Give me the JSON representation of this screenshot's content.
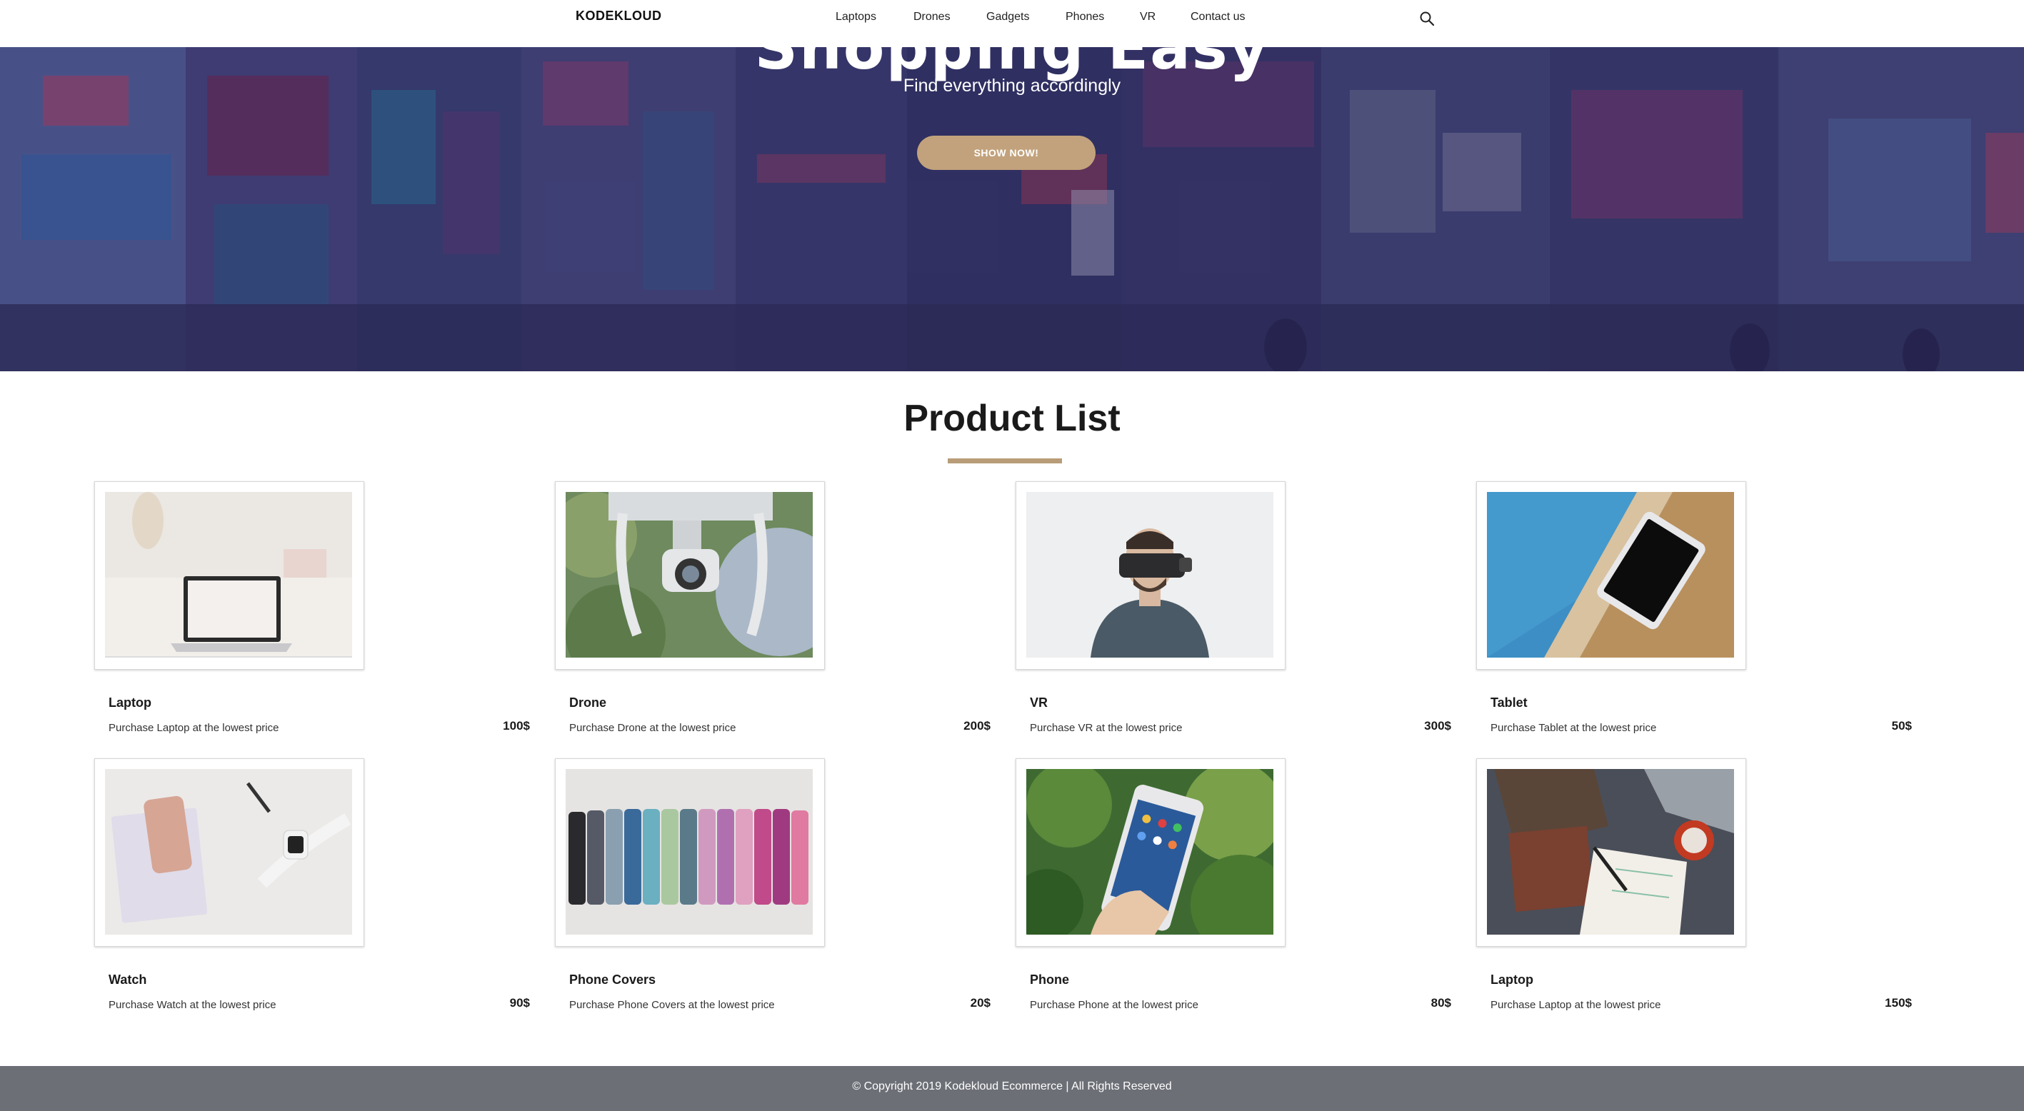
{
  "navbar": {
    "brand": "KODEKLOUD",
    "links": [
      "Laptops",
      "Drones",
      "Gadgets",
      "Phones",
      "VR",
      "Contact us"
    ],
    "search_icon": "search-icon"
  },
  "hero": {
    "title": "Shopping Easy",
    "subtitle": "Find everything accordingly",
    "button_label": "SHOW NOW!",
    "button_color": "#c2a27c"
  },
  "products_section": {
    "title": "Product List",
    "underline_color": "#b89d78",
    "products": [
      {
        "name": "Laptop",
        "description": "Purchase Laptop at the lowest price",
        "price": "100$"
      },
      {
        "name": "Drone",
        "description": "Purchase Drone at the lowest price",
        "price": "200$"
      },
      {
        "name": "VR",
        "description": "Purchase VR at the lowest price",
        "price": "300$"
      },
      {
        "name": "Tablet",
        "description": "Purchase Tablet at the lowest price",
        "price": "50$"
      },
      {
        "name": "Watch",
        "description": "Purchase Watch at the lowest price",
        "price": "90$"
      },
      {
        "name": "Phone Covers",
        "description": "Purchase Phone Covers at the lowest price",
        "price": "20$"
      },
      {
        "name": "Phone",
        "description": "Purchase Phone at the lowest price",
        "price": "80$"
      },
      {
        "name": "Laptop",
        "description": "Purchase Laptop at the lowest price",
        "price": "150$"
      }
    ]
  },
  "footer": {
    "text": "© Copyright 2019 Kodekloud Ecommerce | All Rights Reserved",
    "background": "#6c6f76"
  }
}
